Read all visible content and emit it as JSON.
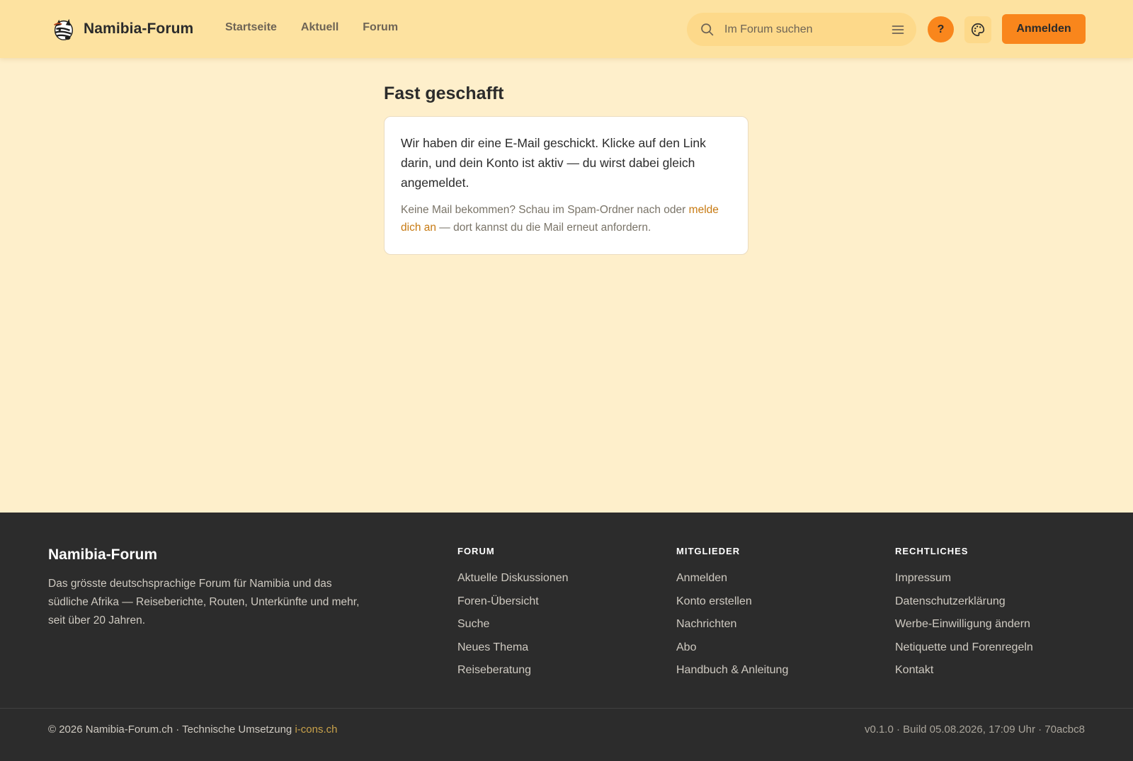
{
  "header": {
    "brand_name": "Namibia-Forum",
    "logo_icon": "zebra-logo-icon",
    "nav": [
      {
        "label": "Startseite"
      },
      {
        "label": "Aktuell"
      },
      {
        "label": "Forum"
      }
    ],
    "search": {
      "placeholder": "Im Forum suchen",
      "value": ""
    },
    "help_label": "?",
    "login_label": "Anmelden"
  },
  "main": {
    "title": "Fast geschafft",
    "message": "Wir haben dir eine E-Mail geschickt. Klicke auf den Link darin, und dein Konto ist aktiv — du wirst dabei gleich angemeldet.",
    "hint_prefix": "Keine Mail bekommen? Schau im Spam-Ordner nach oder",
    "hint_link": "melde dich an",
    "hint_suffix": "— dort kannst du die Mail erneut anfordern."
  },
  "footer": {
    "brand_name": "Namibia-Forum",
    "description": "Das grösste deutschsprachige Forum für Namibia und das südliche Afrika — Reiseberichte, Routen, Unterkünfte und mehr, seit über 20 Jahren.",
    "columns": [
      {
        "title": "FORUM",
        "links": [
          "Aktuelle Diskussionen",
          "Foren-Übersicht",
          "Suche",
          "Neues Thema",
          "Reiseberatung"
        ]
      },
      {
        "title": "MITGLIEDER",
        "links": [
          "Anmelden",
          "Konto erstellen",
          "Nachrichten",
          "Abo",
          "Handbuch & Anleitung"
        ]
      },
      {
        "title": "RECHTLICHES",
        "links": [
          "Impressum",
          "Datenschutzerklärung",
          "Werbe-Einwilligung ändern",
          "Netiquette und Forenregeln",
          "Kontakt"
        ]
      }
    ],
    "copyright_prefix": "© 2026 Namibia-Forum.ch · Technische Umsetzung",
    "copyright_link": "i-cons.ch",
    "build_info": "v0.1.0 · Build 05.08.2026, 17:09 Uhr · 70acbc8"
  },
  "colors": {
    "header_bg": "#fde2a0",
    "page_bg": "#feefcb",
    "accent": "#f9861c",
    "link": "#c77a12",
    "footer_bg": "#2c2c2c"
  }
}
